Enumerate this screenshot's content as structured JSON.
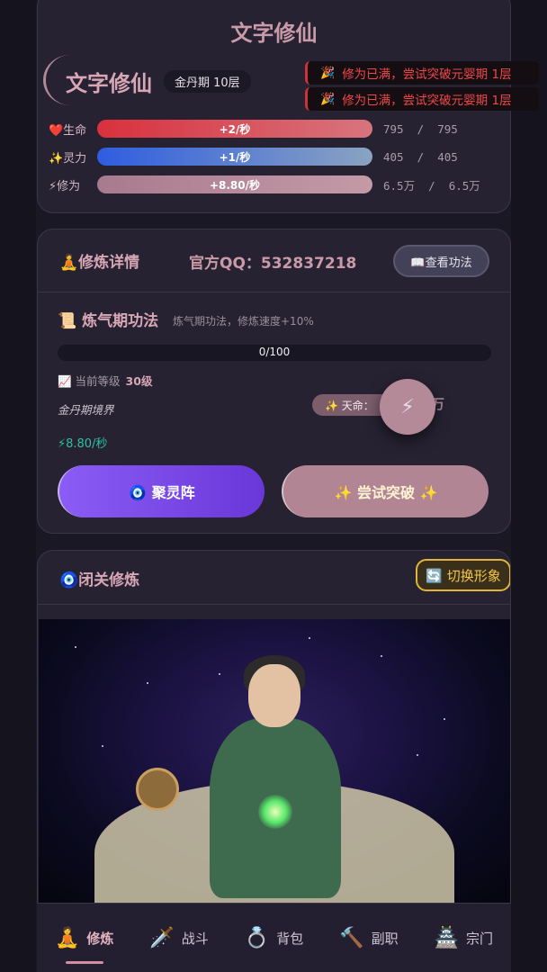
{
  "app_title": "文字修仙",
  "profile": {
    "name": "文字修仙",
    "realm_badge": "金丹期 10层"
  },
  "stats": [
    {
      "label": "❤️生命",
      "rate": "+2/秒",
      "current": "795",
      "max": "795"
    },
    {
      "label": "✨灵力",
      "rate": "+1/秒",
      "current": "405",
      "max": "405"
    },
    {
      "label": "⚡修为",
      "rate": "+8.80/秒",
      "current": "6.5万",
      "max": "6.5万"
    }
  ],
  "toasts": [
    {
      "icon": "🎉",
      "text": "修为已满，尝试突破元婴期 1层"
    },
    {
      "icon": "🎉",
      "text": "修为已满，尝试突破元婴期 1层"
    }
  ],
  "details": {
    "title": "🧘修炼详情",
    "qq": "官方QQ：532837218",
    "view_button": "📖查看功法",
    "technique_title": "📜 炼气期功法",
    "technique_desc": "炼气期功法，修炼速度+10%",
    "progress_text": "0/100",
    "progress_value": 0,
    "level_label": "📈 当前等级",
    "level_value": "30级",
    "realm_text": "金丹期境界",
    "fate_label": "✨ 天命：",
    "fate_tail": "万",
    "fab_icon": "⚡",
    "speed": "⚡8.80/秒",
    "array_button": "🧿 聚灵阵",
    "breakthrough_button": "✨ 尝试突破 ✨"
  },
  "retreat": {
    "title": "🧿闭关修炼",
    "switch_button": "🔄 切换形象"
  },
  "nav": [
    {
      "icon": "🧘",
      "label": "修炼",
      "active": true
    },
    {
      "icon": "🗡️",
      "label": "战斗",
      "active": false
    },
    {
      "icon": "💍",
      "label": "背包",
      "active": false
    },
    {
      "icon": "🔨",
      "label": "副职",
      "active": false
    },
    {
      "icon": "🏯",
      "label": "宗门",
      "active": false
    }
  ]
}
